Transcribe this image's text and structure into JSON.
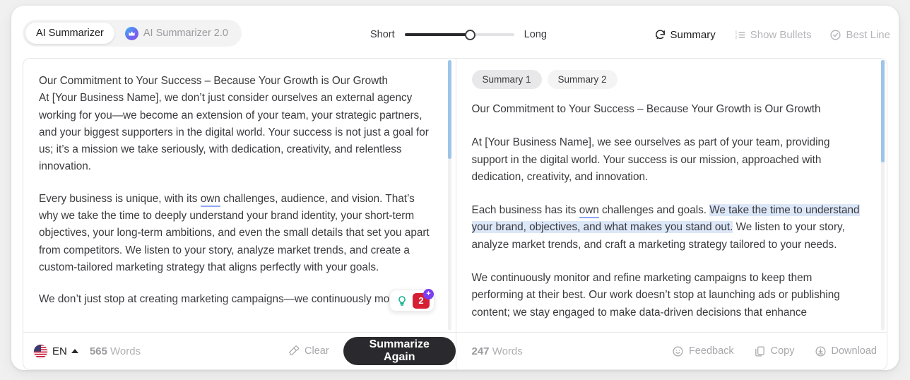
{
  "header": {
    "mode_tabs": [
      {
        "label": "AI Summarizer",
        "active": true,
        "icon": null
      },
      {
        "label": "AI Summarizer 2.0",
        "active": false,
        "icon": "crown-icon"
      }
    ],
    "slider": {
      "min_label": "Short",
      "max_label": "Long",
      "value_percent": 60
    },
    "actions": [
      {
        "label": "Summary",
        "icon": "rotate-refresh-icon",
        "active": true
      },
      {
        "label": "Show Bullets",
        "icon": "numbered-list-icon",
        "active": false
      },
      {
        "label": "Best Line",
        "icon": "check-badge-icon",
        "active": false
      }
    ]
  },
  "left_panel": {
    "paragraphs": [
      {
        "segments": [
          {
            "text": "Our Commitment to Your Success – Because Your Growth is Our Growth\nAt [Your Business Name], we don’t just consider ourselves an external agency working for you—we become an extension of your team, your strategic partners, and your biggest supporters in the digital world. Your success is not just a goal for us; it’s a mission we take seriously, with dedication, creativity, and relentless innovation.",
            "style": "normal"
          }
        ]
      },
      {
        "segments": [
          {
            "text": "Every business is unique, with its ",
            "style": "normal"
          },
          {
            "text": "own",
            "style": "grammar-underline"
          },
          {
            "text": " challenges, audience, and vision. That’s why we take the time to deeply understand your brand identity, your short-term objectives, your long-term ambitions, and even the small details that set you apart from competitors. We listen to your story, analyze market trends, and create a custom-tailored marketing strategy that aligns perfectly with your goals.",
            "style": "normal"
          }
        ]
      },
      {
        "segments": [
          {
            "text": "We don’t just stop at creating marketing campaigns—we continuously monitor,",
            "style": "normal"
          }
        ]
      }
    ],
    "suggestion_widget": {
      "bulb_icon": "lightbulb-icon",
      "count": "2",
      "plus_label": "+"
    },
    "scroll_thumb_top": 0,
    "scroll_thumb_height": 140
  },
  "right_panel": {
    "summary_tabs": [
      {
        "label": "Summary 1",
        "active": true
      },
      {
        "label": "Summary 2",
        "active": false
      }
    ],
    "paragraphs": [
      {
        "segments": [
          {
            "text": "Our Commitment to Your Success – Because Your Growth is Our Growth",
            "style": "normal"
          }
        ]
      },
      {
        "segments": [
          {
            "text": "At [Your Business Name], we see ourselves as part of your team, providing support in the digital world. Your success is our mission, approached with dedication, creativity, and innovation.",
            "style": "normal"
          }
        ]
      },
      {
        "segments": [
          {
            "text": "Each business has its ",
            "style": "normal"
          },
          {
            "text": "own",
            "style": "grammar-underline"
          },
          {
            "text": " challenges and goals. ",
            "style": "normal"
          },
          {
            "text": "We take the time to understand your brand, objectives, and what makes you stand out.",
            "style": "highlight"
          },
          {
            "text": " We listen to your story, analyze market trends, and craft a marketing strategy tailored to your needs.",
            "style": "normal"
          }
        ]
      },
      {
        "segments": [
          {
            "text": "We continuously monitor and refine marketing campaigns to keep them performing at their best. Our work doesn’t stop at launching ads or publishing content; we stay engaged to make data-driven decisions that enhance",
            "style": "normal"
          }
        ]
      }
    ],
    "scroll_thumb_top": 0,
    "scroll_thumb_height": 145
  },
  "footer": {
    "language": {
      "flag_icon": "us-flag-icon",
      "code": "EN",
      "caret_icon": "caret-up-icon"
    },
    "left_word_count_number": "565",
    "left_word_count_unit": "Words",
    "clear_label": "Clear",
    "clear_icon": "eraser-icon",
    "primary_label": "Summarize Again",
    "right_word_count_number": "247",
    "right_word_count_unit": "Words",
    "right_actions": [
      {
        "label": "Feedback",
        "icon": "smiley-face-icon"
      },
      {
        "label": "Copy",
        "icon": "copy-pages-icon"
      },
      {
        "label": "Download",
        "icon": "download-circle-icon"
      }
    ]
  },
  "colors": {
    "accent_dark": "#2a2a2e",
    "scrollbar_thumb": "#9ec4e8",
    "selection_highlight": "#dce7f8",
    "grammar_underline": "#8fa6f5",
    "badge_red": "#d61f32",
    "badge_purple": "#7b3ff2",
    "bulb_green": "#0fae8a"
  }
}
